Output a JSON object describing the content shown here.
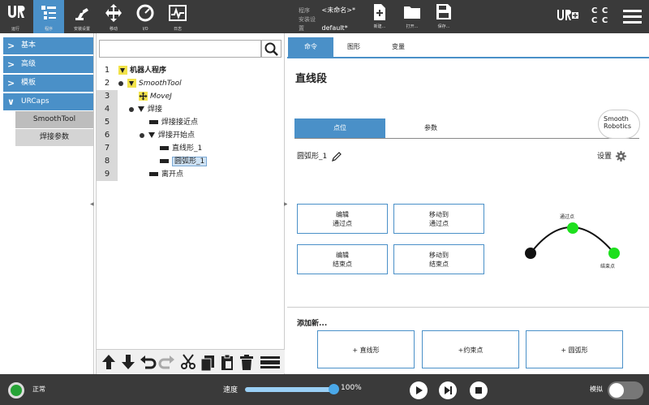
{
  "topbar": {
    "nav": [
      {
        "label": "运行",
        "icon": "ur-logo-icon"
      },
      {
        "label": "程序",
        "icon": "program-icon",
        "active": true
      },
      {
        "label": "安装设置",
        "icon": "robot-arm-icon"
      },
      {
        "label": "移动",
        "icon": "move-arrows-icon"
      },
      {
        "label": "I/O",
        "icon": "io-gauge-icon"
      },
      {
        "label": "日志",
        "icon": "log-chart-icon"
      }
    ],
    "program_key": "程序",
    "program_value": "<未命名>*",
    "install_key": "安装设置",
    "install_value": "default*",
    "file_buttons": [
      {
        "label": "新建...",
        "icon": "new-file-icon"
      },
      {
        "label": "打开...",
        "icon": "open-folder-icon"
      },
      {
        "label": "保存...",
        "icon": "save-icon"
      }
    ],
    "cc_label": "C C\nC C"
  },
  "sidebar": {
    "categories": [
      "基本",
      "高级",
      "模板",
      "URCaps"
    ],
    "subitems": [
      "SmoothTool",
      "焊接参数"
    ]
  },
  "tree": {
    "line_numbers": [
      "1",
      "2",
      "3",
      "4",
      "5",
      "6",
      "7",
      "8",
      "9"
    ],
    "nodes": [
      "机器人程序",
      "SmoothTool",
      "MoveJ",
      "焊接",
      "焊接接近点",
      "焊接开始点",
      "直线形_1",
      "圆弧形_1",
      "离开点"
    ]
  },
  "main": {
    "tabs": [
      "命令",
      "图形",
      "变量"
    ],
    "title": "直线段",
    "subtabs": [
      "点位",
      "参数"
    ],
    "logo_text": [
      "Smooth",
      "Robotics"
    ],
    "shape_name": "圆弧形_1",
    "settings_label": "设置",
    "buttons": [
      {
        "line1": "编辑",
        "line2": "通过点"
      },
      {
        "line1": "移动到",
        "line2": "通过点"
      },
      {
        "line1": "编辑",
        "line2": "结束点"
      },
      {
        "line1": "移动到",
        "line2": "结束点"
      }
    ],
    "diagram": {
      "pass_label": "通过点",
      "end_label": "结束点"
    },
    "add_new_label": "添加新...",
    "add_buttons": [
      "+ 直线形",
      "+约束点",
      "+ 圆弧形"
    ]
  },
  "footer": {
    "status": "正常",
    "speed_label": "速度",
    "speed_value": "100%",
    "speed_fraction": 1.0,
    "sim_label": "模拟"
  },
  "colors": {
    "accent": "#4a90c8",
    "bar": "#3a3a3a",
    "status_ok": "#26a336",
    "point_green": "#1ee01e"
  }
}
